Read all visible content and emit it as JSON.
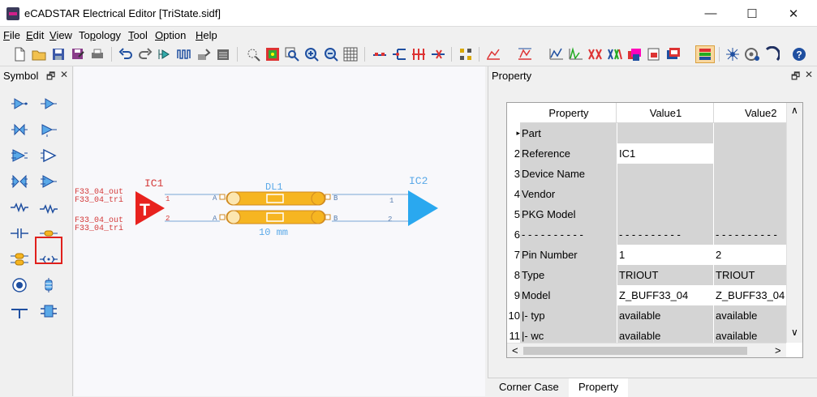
{
  "window": {
    "title": "eCADSTAR Electrical Editor [TriState.sidf]",
    "minimize": "—",
    "maximize": "☐",
    "close": "✕"
  },
  "menu": [
    {
      "pre": "",
      "ul": "F",
      "post": "ile"
    },
    {
      "pre": "",
      "ul": "E",
      "post": "dit"
    },
    {
      "pre": "",
      "ul": "V",
      "post": "iew"
    },
    {
      "pre": "To",
      "ul": "p",
      "post": "ology"
    },
    {
      "pre": "",
      "ul": "T",
      "post": "ool"
    },
    {
      "pre": "",
      "ul": "O",
      "post": "ption"
    },
    {
      "pre": "",
      "ul": "H",
      "post": "elp"
    }
  ],
  "symbol_panel": {
    "title": "Symbol",
    "pin": "🗗",
    "close": "✕"
  },
  "property_panel": {
    "title": "Property",
    "pin": "🗗",
    "close": "✕"
  },
  "schematic": {
    "ic1_label": "IC1",
    "ic2_label": "IC2",
    "dl1_label": "DL1",
    "length_label": "10 mm",
    "net_labels": [
      "F33_04_out",
      "F33_04_tri",
      "F33_04_out",
      "F33_04_tri"
    ],
    "ic1_pin1": "1",
    "ic1_pin2": "2",
    "ic2_pin1": "1",
    "ic2_pin2": "2",
    "port_a": "A",
    "port_b": "B",
    "ic1_glyph": "T"
  },
  "property_table": {
    "headers": [
      "Property",
      "Value1",
      "Value2"
    ],
    "rows": [
      {
        "num": "",
        "marker": "▸",
        "name": "Part",
        "v1": "",
        "v2": "",
        "v1white": false,
        "v2white": false
      },
      {
        "num": "2",
        "marker": "",
        "name": "Reference",
        "v1": "IC1",
        "v2": "",
        "v1white": true,
        "v2white": false
      },
      {
        "num": "3",
        "marker": "",
        "name": "Device Name",
        "v1": "",
        "v2": "",
        "v1white": false,
        "v2white": false
      },
      {
        "num": "4",
        "marker": "",
        "name": "Vendor",
        "v1": "",
        "v2": "",
        "v1white": false,
        "v2white": false
      },
      {
        "num": "5",
        "marker": "",
        "name": "PKG Model",
        "v1": "",
        "v2": "",
        "v1white": false,
        "v2white": false
      },
      {
        "num": "6",
        "marker": "",
        "name": "- - - - - - - - - -",
        "v1": "- - - - - - - - - -",
        "v2": "- - - - - - - - - -",
        "v1white": false,
        "v2white": false
      },
      {
        "num": "7",
        "marker": "",
        "name": "Pin Number",
        "v1": "1",
        "v2": "2",
        "v1white": true,
        "v2white": true
      },
      {
        "num": "8",
        "marker": "",
        "name": "Type",
        "v1": "TRIOUT",
        "v2": "TRIOUT",
        "v1white": false,
        "v2white": false
      },
      {
        "num": "9",
        "marker": "",
        "name": "Model",
        "v1": "Z_BUFF33_04",
        "v2": "Z_BUFF33_04",
        "v1white": true,
        "v2white": true
      },
      {
        "num": "10",
        "marker": "",
        "name": "|- typ",
        "v1": "available",
        "v2": "available",
        "v1white": false,
        "v2white": false
      },
      {
        "num": "11",
        "marker": "",
        "name": "|- wc",
        "v1": "available",
        "v2": "available",
        "v1white": false,
        "v2white": false
      }
    ],
    "scroll_up": "∧",
    "scroll_down": "∨",
    "scroll_left": "<",
    "scroll_right": ">"
  },
  "bottom_tabs": [
    "Corner Case",
    "Property"
  ],
  "colors": {
    "accent_red": "#e8221e",
    "ic2_blue": "#2aa8ef",
    "trace_orange": "#f6b521",
    "net_red": "#d43a3a",
    "wire_blue": "#7aa6d6"
  }
}
